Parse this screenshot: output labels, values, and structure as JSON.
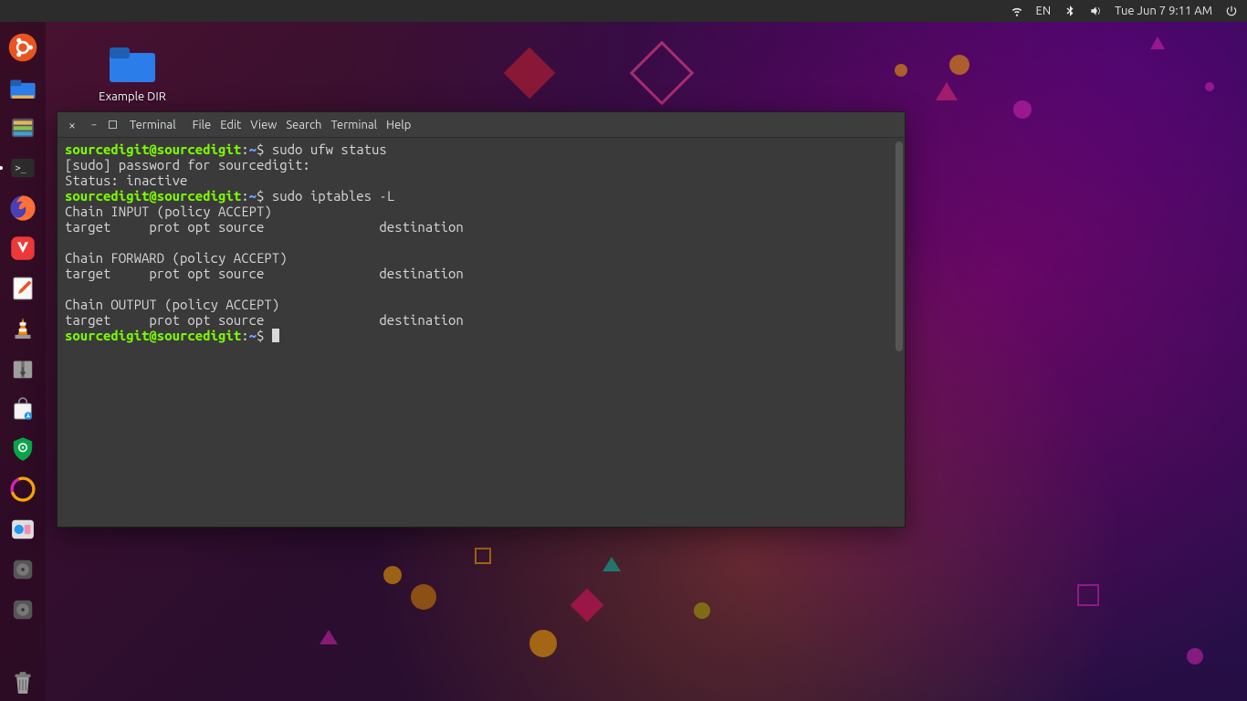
{
  "topbar": {
    "lang": "EN",
    "datetime": "Tue Jun  7  9:11 AM"
  },
  "desktop": {
    "folder_label": "Example DIR"
  },
  "dock": {
    "items": [
      {
        "name": "ubuntu-dash"
      },
      {
        "name": "files"
      },
      {
        "name": "file-manager-alt"
      },
      {
        "name": "terminal"
      },
      {
        "name": "firefox"
      },
      {
        "name": "vivaldi"
      },
      {
        "name": "text-editor"
      },
      {
        "name": "vlc"
      },
      {
        "name": "archive-manager"
      },
      {
        "name": "software-updater"
      },
      {
        "name": "system-settings"
      },
      {
        "name": "sync-app"
      },
      {
        "name": "web-app"
      },
      {
        "name": "disk-utility"
      },
      {
        "name": "disk-utility-2"
      }
    ],
    "trash": "trash"
  },
  "window": {
    "title": "Terminal",
    "menu": [
      "File",
      "Edit",
      "View",
      "Search",
      "Terminal",
      "Help"
    ]
  },
  "terminal": {
    "prompt_user": "sourcedigit@sourcedigit",
    "prompt_path": "~",
    "prompt_symbol": "$",
    "lines": [
      {
        "type": "prompt",
        "cmd": "sudo ufw status"
      },
      {
        "type": "out",
        "text": "[sudo] password for sourcedigit:"
      },
      {
        "type": "out",
        "text": "Status: inactive"
      },
      {
        "type": "prompt",
        "cmd": "sudo iptables -L"
      },
      {
        "type": "out",
        "text": "Chain INPUT (policy ACCEPT)"
      },
      {
        "type": "out",
        "text": "target     prot opt source               destination"
      },
      {
        "type": "out",
        "text": ""
      },
      {
        "type": "out",
        "text": "Chain FORWARD (policy ACCEPT)"
      },
      {
        "type": "out",
        "text": "target     prot opt source               destination"
      },
      {
        "type": "out",
        "text": ""
      },
      {
        "type": "out",
        "text": "Chain OUTPUT (policy ACCEPT)"
      },
      {
        "type": "out",
        "text": "target     prot opt source               destination"
      },
      {
        "type": "prompt",
        "cmd": ""
      }
    ]
  }
}
